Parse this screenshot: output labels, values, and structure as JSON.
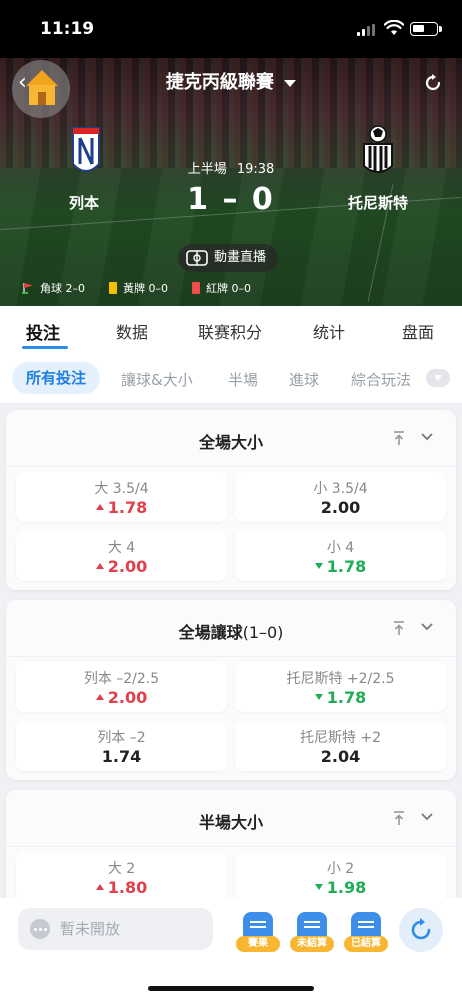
{
  "status_bar": {
    "time": "11:19"
  },
  "header": {
    "league": "捷克丙級聯賽",
    "home_team": "列本",
    "away_team": "托尼斯特",
    "period": "上半場",
    "clock": "19:38",
    "score": "1 – 0",
    "live_label": "動畫直播",
    "stats": {
      "corners": "角球 2–0",
      "yellow": "黃牌 0–0",
      "red": "紅牌 0–0"
    }
  },
  "tabs": [
    "投注",
    "数据",
    "联赛积分",
    "统计",
    "盘面"
  ],
  "subtabs": [
    "所有投注",
    "讓球&大小",
    "半場",
    "進球",
    "綜合玩法"
  ],
  "markets": [
    {
      "title": "全場大小",
      "title_sub": "",
      "odds": [
        {
          "label": "大 3.5/4",
          "value": "1.78",
          "trend": "up"
        },
        {
          "label": "小 3.5/4",
          "value": "2.00",
          "trend": "flat"
        },
        {
          "label": "大 4",
          "value": "2.00",
          "trend": "up"
        },
        {
          "label": "小 4",
          "value": "1.78",
          "trend": "down"
        }
      ]
    },
    {
      "title": "全場讓球",
      "title_sub": "(1–0)",
      "odds": [
        {
          "label": "列本 –2/2.5",
          "value": "2.00",
          "trend": "up"
        },
        {
          "label": "托尼斯特 +2/2.5",
          "value": "1.78",
          "trend": "down"
        },
        {
          "label": "列本 –2",
          "value": "1.74",
          "trend": "flat"
        },
        {
          "label": "托尼斯特 +2",
          "value": "2.04",
          "trend": "flat"
        }
      ]
    },
    {
      "title": "半場大小",
      "title_sub": "",
      "odds": [
        {
          "label": "大 2",
          "value": "1.80",
          "trend": "up"
        },
        {
          "label": "小 2",
          "value": "1.98",
          "trend": "down"
        }
      ]
    }
  ],
  "bottom": {
    "chat_placeholder": "暫未開放",
    "results": "賽果",
    "unsettled": "未結算",
    "settled": "已結算"
  },
  "colors": {
    "accent": "#2b8de8",
    "up": "#e0404c",
    "down": "#1fae56",
    "badge": "#f7b733"
  }
}
